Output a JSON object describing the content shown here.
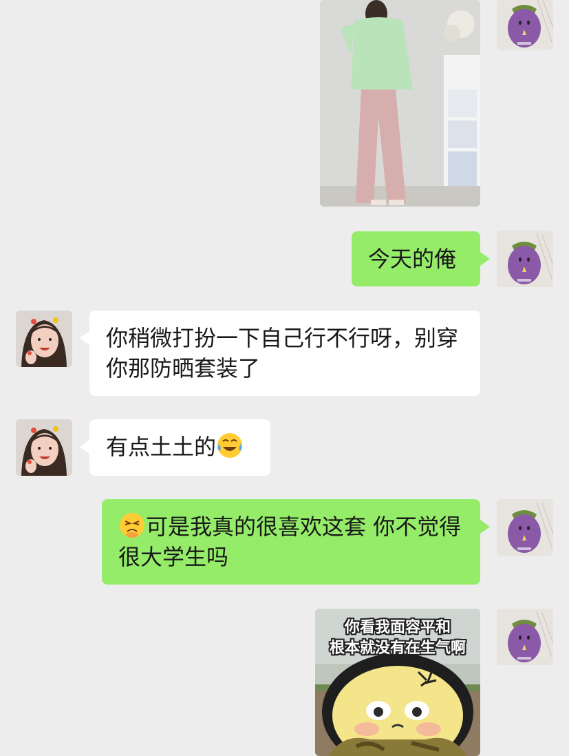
{
  "messages": [
    {
      "sender": "me",
      "type": "image",
      "description": "photo"
    },
    {
      "sender": "me",
      "type": "text",
      "text": "今天的俺"
    },
    {
      "sender": "friend",
      "type": "text",
      "text": "你稍微打扮一下自己行不行呀，别穿你那防晒套装了"
    },
    {
      "sender": "friend",
      "type": "text",
      "text": "有点土土的",
      "trailing_emoji": "laughing-crying"
    },
    {
      "sender": "me",
      "type": "text",
      "leading_emoji": "persevering-face",
      "text": "可是我真的很喜欢这套 你不觉得很大学生吗"
    },
    {
      "sender": "me",
      "type": "sticker",
      "caption_line1": "你看我面容平和",
      "caption_line2": "根本就没有在生气啊"
    }
  ],
  "my_avatar": {
    "icon": "eggplant-avatar-icon"
  },
  "friend_avatar": {
    "icon": "girl-avatar-icon"
  },
  "colors": {
    "background": "#ededed",
    "my_bubble": "#95ec69",
    "friend_bubble": "#ffffff",
    "text": "#191919"
  }
}
